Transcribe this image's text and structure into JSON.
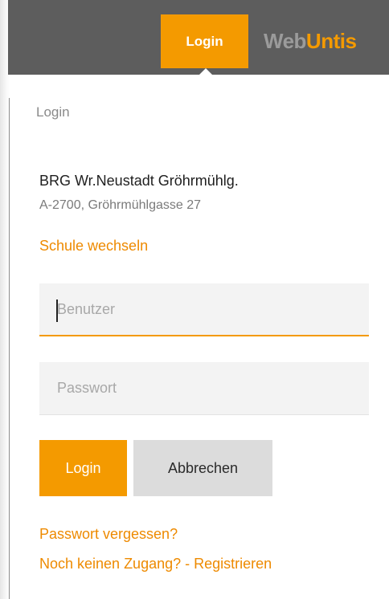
{
  "header": {
    "login_tab_label": "Login",
    "brand_web": "Web",
    "brand_untis": "Untis"
  },
  "page": {
    "title": "Login"
  },
  "school": {
    "name": "BRG Wr.Neustadt Gröhrmühlg.",
    "address": "A-2700, Gröhrmühlgasse 27",
    "switch_label": "Schule wechseln"
  },
  "form": {
    "username_placeholder": "Benutzer",
    "password_placeholder": "Passwort",
    "login_button": "Login",
    "cancel_button": "Abbrechen"
  },
  "links": {
    "forgot_password": "Passwort vergessen?",
    "register": "Noch keinen Zugang? - Registrieren"
  },
  "colors": {
    "accent": "#f49a00",
    "header_bg": "#5d5d5d",
    "link": "#ee8a00",
    "cancel_bg": "#dcdcdc"
  }
}
